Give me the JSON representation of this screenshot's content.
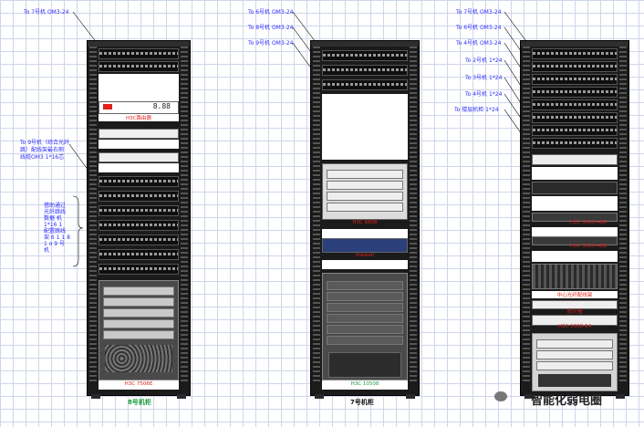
{
  "annotations": {
    "r8": {
      "to7": "To 7号机 OM3-24",
      "to9_line1": "To 9号机（综合光纤",
      "to9_line2": "跳）配线架最右侧",
      "to9_line3": "线缆OM3 1*16芯",
      "side_text": [
        "借助通过",
        "光纤跳线",
        "数据 机",
        "1*16 1",
        "配置跳线",
        "架 6 1 1 8",
        "1 o 9 号",
        "机"
      ]
    },
    "r7": {
      "to6": "To 6号机 OM3-24",
      "to8": "To 8号机 OM3-24",
      "to9": "To 9号机 OM3-24"
    },
    "r1": {
      "to7": "To 7号机 OM3-24",
      "to6": "To 6号机 OM3-24",
      "to4": "To 4号机 OM3-24",
      "to2": "To 2号机 1*24",
      "to3": "To 3号机 1*24",
      "to4b": "To 4号机 1*24",
      "to_room": "To 楼层机柜 1*24"
    }
  },
  "racks": {
    "r8": {
      "router": "H3C路由器",
      "switch": "H3C 7506E",
      "caption": "8号机柜",
      "display_digits": "8.88"
    },
    "r7": {
      "switch": "H3C 6608",
      "firewall": "firewall",
      "switch_big": "H3C 10508",
      "caption": "7号机柜"
    },
    "r1": {
      "s1": "H3C 5500-48A",
      "s2": "H3C 5500-48B",
      "fiber": "中心光纤配线架",
      "router": "防火墙",
      "small": "H3C 5300-24"
    }
  },
  "watermark": "智能化弱电圈",
  "colors": {
    "annotation": "#2c2cff",
    "device_red": "#e0201a",
    "caption_green": "#1a9a3a"
  }
}
